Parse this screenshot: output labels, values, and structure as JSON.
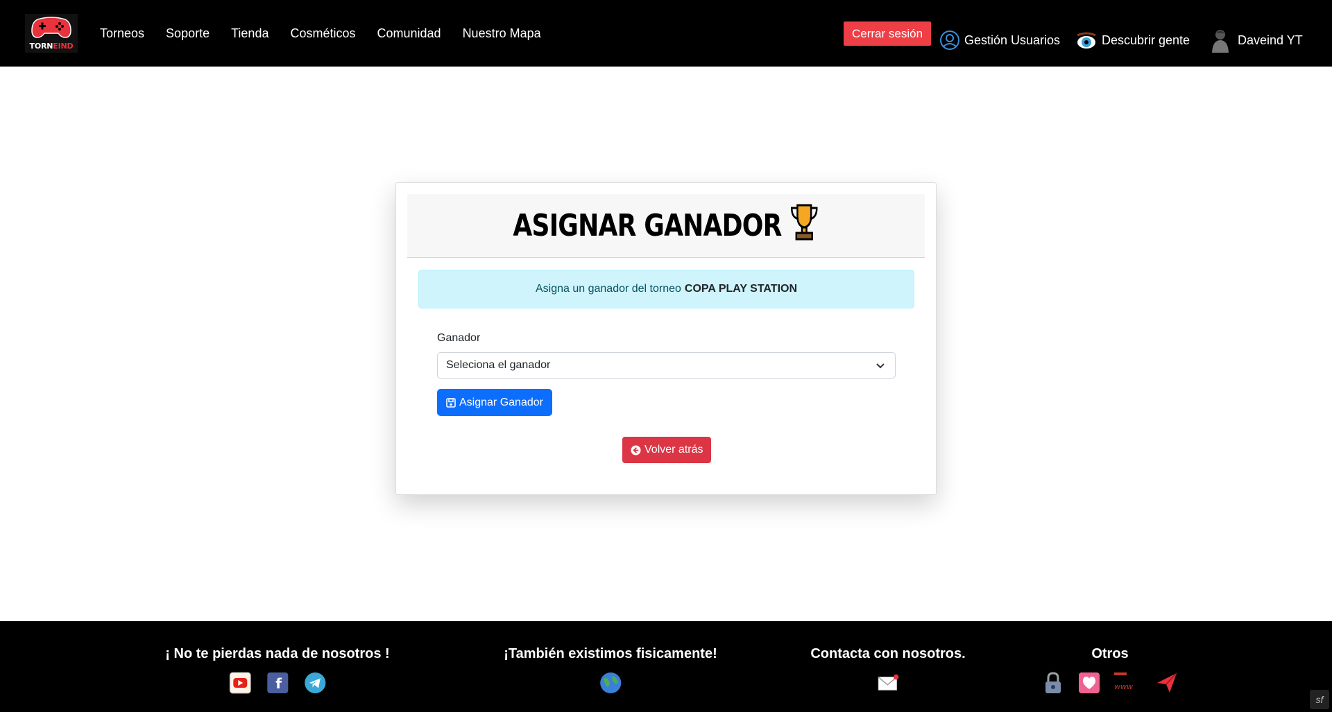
{
  "navbar": {
    "logo": {
      "text_a": "TORN",
      "text_b": "EIND"
    },
    "links": [
      "Torneos",
      "Soporte",
      "Tienda",
      "Cosméticos",
      "Comunidad",
      "Nuestro Mapa"
    ],
    "logout_label": "Cerrar sesión",
    "user_management_label": "Gestión Usuarios",
    "discover_label": "Descubrir gente",
    "username": "Daveind YT"
  },
  "card": {
    "title": "ASIGNAR GANADOR",
    "alert_text": "Asigna un ganador del torneo",
    "tournament_name": "COPA PLAY STATION",
    "winner_label": "Ganador",
    "winner_select_value": "Seleciona el ganador",
    "assign_button_label": "Asignar Ganador",
    "back_button_label": "Volver atrás"
  },
  "footer": {
    "social_heading": "¡ No te pierdas nada de nosotros !",
    "physical_heading": "¡También existimos fisicamente!",
    "contact_heading": "Contacta con nosotros.",
    "other_heading": "Otros",
    "social_icons": [
      "youtube-icon",
      "facebook-icon",
      "telegram-icon"
    ],
    "physical_icons": [
      "globe-icon"
    ],
    "contact_icons": [
      "mail-icon"
    ],
    "other_icons": [
      "lock-icon",
      "heart-icon",
      "www-icon",
      "paper-plane-icon"
    ]
  },
  "colors": {
    "navbar_bg": "#000000",
    "logout_button": "#ee3e46",
    "primary_button": "#0d6efd",
    "danger_button": "#dc3545",
    "alert_bg": "#cff4fc"
  }
}
